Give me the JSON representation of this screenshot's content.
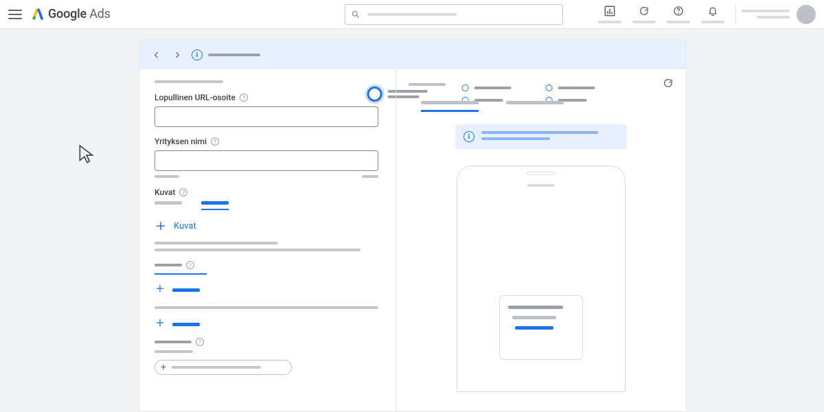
{
  "app": {
    "brand_primary": "Google",
    "brand_secondary": "Ads"
  },
  "form": {
    "final_url_label": "Lopullinen URL-osoite",
    "business_name_label": "Yrityksen nimi",
    "images_label": "Kuvat",
    "add_images_label": "Kuvat"
  }
}
